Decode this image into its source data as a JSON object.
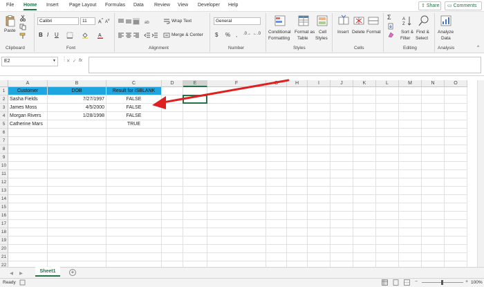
{
  "menu": {
    "tabs": [
      "File",
      "Home",
      "Insert",
      "Page Layout",
      "Formulas",
      "Data",
      "Review",
      "View",
      "Developer",
      "Help"
    ],
    "active_index": 1,
    "share_label": "Share",
    "comments_label": "Comments"
  },
  "ribbon": {
    "clipboard": {
      "paste_label": "Paste",
      "group_label": "Clipboard"
    },
    "font": {
      "font_name": "Calibri",
      "font_size": "11",
      "group_label": "Font"
    },
    "alignment": {
      "wrap_text_label": "Wrap Text",
      "merge_label": "Merge & Center",
      "group_label": "Alignment"
    },
    "number": {
      "format": "General",
      "group_label": "Number"
    },
    "styles": {
      "conditional_label_1": "Conditional",
      "conditional_label_2": "Formatting",
      "format_table_1": "Format as",
      "format_table_2": "Table",
      "cell_styles_1": "Cell",
      "cell_styles_2": "Styles",
      "group_label": "Styles"
    },
    "cells": {
      "insert_label": "Insert",
      "delete_label": "Delete",
      "format_label": "Format",
      "group_label": "Cells"
    },
    "editing": {
      "sort_label_1": "Sort &",
      "sort_label_2": "Filter",
      "find_label_1": "Find &",
      "find_label_2": "Select",
      "group_label": "Editing"
    },
    "analysis": {
      "analyze_label_1": "Analyze",
      "analyze_label_2": "Data",
      "group_label": "Analysis"
    }
  },
  "formula_bar": {
    "name_box": "E2",
    "cancel_symbol": "✕",
    "enter_symbol": "✓",
    "fx_symbol": "fx",
    "formula": ""
  },
  "columns": [
    "A",
    "B",
    "C",
    "D",
    "E",
    "F",
    "G",
    "H",
    "I",
    "J",
    "K",
    "L",
    "M",
    "N",
    "O"
  ],
  "selected_column": "E",
  "rows": [
    "1",
    "2",
    "3",
    "4",
    "5",
    "6",
    "7",
    "8",
    "9",
    "10",
    "11",
    "12",
    "13",
    "14",
    "15",
    "16",
    "17",
    "18",
    "19",
    "20",
    "21",
    "22"
  ],
  "table": {
    "headers": [
      "Customer",
      "DOB",
      "Result for ISBLANK"
    ],
    "rows": [
      [
        "Sasha Fields",
        "7/27/1997",
        "FALSE"
      ],
      [
        "James Moss",
        "4/5/2000",
        "FALSE"
      ],
      [
        "Morgan  Rivers",
        "1/28/1998",
        "FALSE"
      ],
      [
        "Catherine Mars",
        "",
        "TRUE"
      ]
    ]
  },
  "header_fill_color": "#1fa5df",
  "arrow_color": "#e02020",
  "sheet_tabs": {
    "active": "Sheet1",
    "add_symbol": "+"
  },
  "status": {
    "ready": "Ready",
    "zoom": "100%"
  }
}
